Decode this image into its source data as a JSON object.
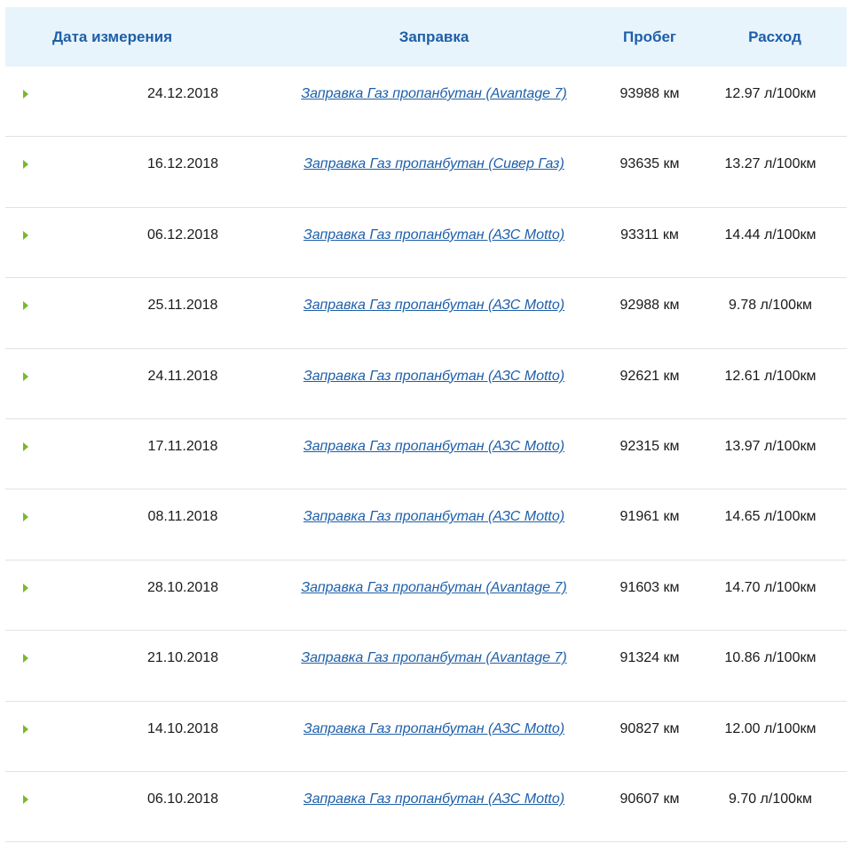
{
  "table": {
    "headers": {
      "date": "Дата измерения",
      "fuel": "Заправка",
      "odometer": "Пробег",
      "consumption": "Расход"
    },
    "rows": [
      {
        "date": "24.12.2018",
        "fuel": "Заправка Газ пропанбутан (Avantage 7)",
        "odometer": "93988 км",
        "consumption": "12.97 л/100км"
      },
      {
        "date": "16.12.2018",
        "fuel": "Заправка Газ пропанбутан (Сивер Газ)",
        "odometer": "93635 км",
        "consumption": "13.27 л/100км"
      },
      {
        "date": "06.12.2018",
        "fuel": "Заправка Газ пропанбутан (АЗС Motto)",
        "odometer": "93311 км",
        "consumption": "14.44 л/100км"
      },
      {
        "date": "25.11.2018",
        "fuel": "Заправка Газ пропанбутан (АЗС Motto)",
        "odometer": "92988 км",
        "consumption": "9.78 л/100км"
      },
      {
        "date": "24.11.2018",
        "fuel": "Заправка Газ пропанбутан (АЗС Motto)",
        "odometer": "92621 км",
        "consumption": "12.61 л/100км"
      },
      {
        "date": "17.11.2018",
        "fuel": "Заправка Газ пропанбутан (АЗС Motto)",
        "odometer": "92315 км",
        "consumption": "13.97 л/100км"
      },
      {
        "date": "08.11.2018",
        "fuel": "Заправка Газ пропанбутан (АЗС Motto)",
        "odometer": "91961 км",
        "consumption": "14.65 л/100км"
      },
      {
        "date": "28.10.2018",
        "fuel": "Заправка Газ пропанбутан (Avantage 7)",
        "odometer": "91603 км",
        "consumption": "14.70 л/100км"
      },
      {
        "date": "21.10.2018",
        "fuel": "Заправка Газ пропанбутан (Avantage 7)",
        "odometer": "91324 км",
        "consumption": "10.86 л/100км"
      },
      {
        "date": "14.10.2018",
        "fuel": "Заправка Газ пропанбутан (АЗС Motto)",
        "odometer": "90827 км",
        "consumption": "12.00 л/100км"
      },
      {
        "date": "06.10.2018",
        "fuel": "Заправка Газ пропанбутан (АЗС Motto)",
        "odometer": "90607 км",
        "consumption": "9.70 л/100км"
      }
    ]
  },
  "icons": {
    "row_expand": "triangle-right-icon"
  },
  "colors": {
    "header_bg": "#e8f4fc",
    "header_text": "#1e5fa8",
    "link": "#1e5fa8",
    "arrow": "#7ab829"
  }
}
